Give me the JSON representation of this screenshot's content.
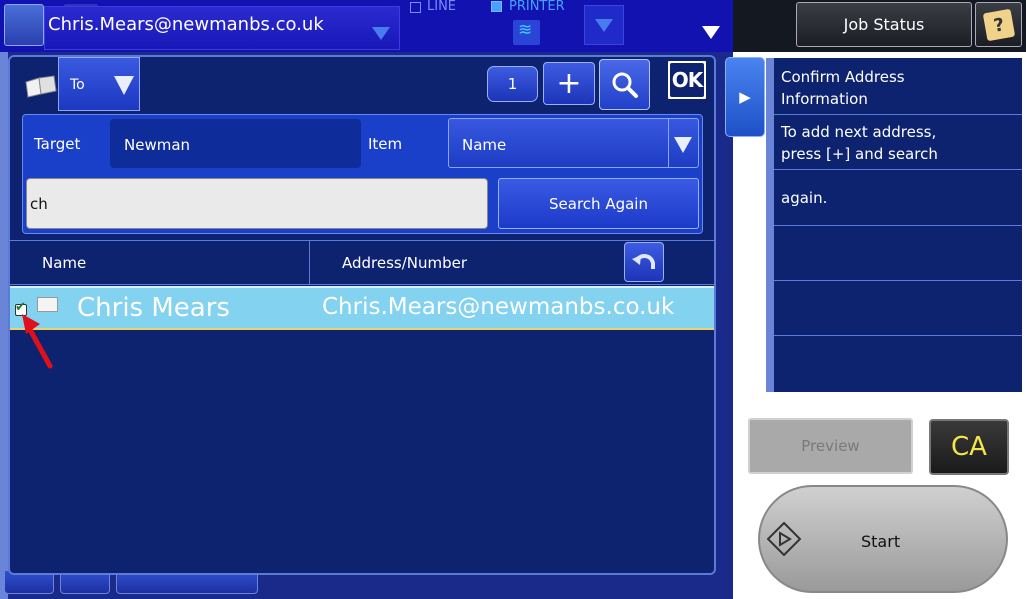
{
  "header": {
    "destination": "Chris.Mears@newmanbs.co.uk",
    "line_label": "LINE",
    "printer_label": "PRINTER",
    "job_status_label": "Job Status"
  },
  "dialog": {
    "address_type": "To",
    "count": "1",
    "plus_label": "+",
    "ok_label": "OK",
    "target_label": "Target",
    "target_value": "Newman",
    "item_label": "Item",
    "item_value": "Name",
    "keyword_value": "ch",
    "search_again_label": "Search Again"
  },
  "table": {
    "columns": [
      "Name",
      "Address/Number"
    ],
    "rows": [
      {
        "name": "Chris Mears",
        "address": "Chris.Mears@newmanbs.co.uk",
        "checked": true
      }
    ]
  },
  "info_panel": {
    "messages": [
      "Confirm Address\nInformation",
      "To add next address,\npress [+] and search",
      "again."
    ]
  },
  "actions": {
    "preview_label": "Preview",
    "ca_label": "CA",
    "start_label": "Start"
  },
  "colors": {
    "header_blue": "#1212b0",
    "dialog_navy": "#0d2370",
    "selected_row": "#82d2f0",
    "ca_text": "#f2e64a"
  }
}
